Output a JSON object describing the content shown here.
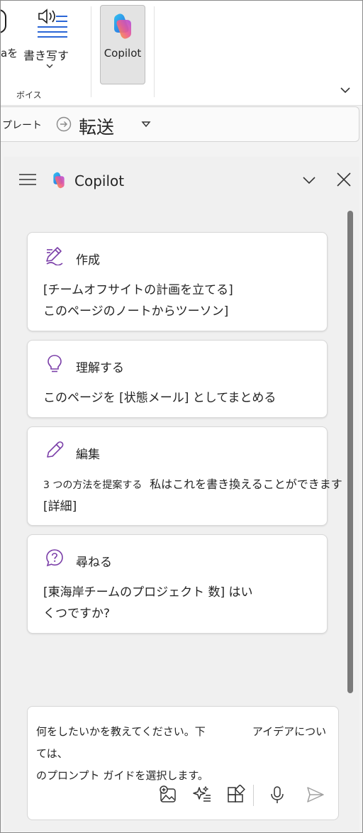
{
  "ribbon": {
    "partial_label": "aを",
    "transcribe_label": "書き写す",
    "voice_group_label": "ボイス",
    "copilot_label": "Copilot"
  },
  "toolbar": {
    "template_label": "プレート",
    "forward_label": "転送"
  },
  "pane": {
    "title": "Copilot",
    "cards": [
      {
        "icon": "compose-icon",
        "title": "作成",
        "line1": "[チームオフサイトの計画を立てる]",
        "line2": "このページのノートからツーソン]"
      },
      {
        "icon": "lightbulb-icon",
        "title": "理解する",
        "line1": "このページを [状態メール] としてまとめる"
      },
      {
        "icon": "pencil-icon",
        "title": "編集",
        "line1_small": "3 つの方法を提案する",
        "line1_rest": "私はこれを書き換えることができます",
        "line2": "[詳細]"
      },
      {
        "icon": "question-icon",
        "title": "尋ねる",
        "line1": "[東海岸チームのプロジェクト 数] はい",
        "line2": "くつですか?"
      }
    ],
    "input": {
      "text_part1": "何をしたいかを教えてください。下",
      "text_part2": "アイデアについては、",
      "text_line2": "のプロンプト ガイドを選択します。"
    }
  },
  "colors": {
    "accent_purple": "#7a3ea8",
    "scrollbar": "#7a7a7a"
  }
}
